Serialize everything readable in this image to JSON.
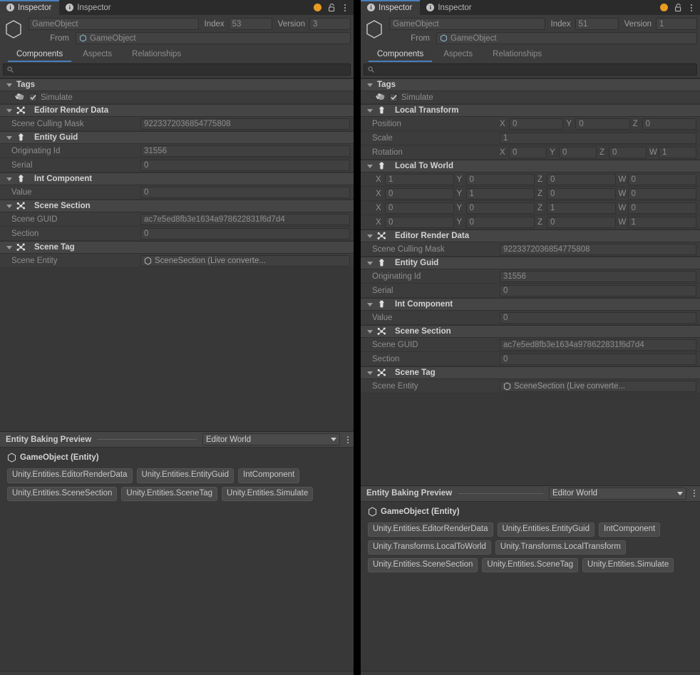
{
  "window": {
    "tabs": [
      {
        "label": "Inspector",
        "icon": "info-icon",
        "active": true
      },
      {
        "label": "Inspector",
        "icon": "info-icon",
        "active": false
      }
    ],
    "header_icons": [
      "status-dot-icon",
      "lock-open-icon",
      "kebab-menu-icon"
    ],
    "accent_color": "#4a7ebb",
    "status_dot_color": "#ea9b22"
  },
  "left": {
    "entity": {
      "name": "GameObject",
      "index_label": "Index",
      "index_value": "53",
      "version_label": "Version",
      "version_value": "3",
      "from_label": "From",
      "from_value": "GameObject"
    },
    "subtabs": [
      {
        "label": "Components",
        "active": true
      },
      {
        "label": "Aspects",
        "active": false
      },
      {
        "label": "Relationships",
        "active": false
      }
    ],
    "search": {
      "value": "",
      "placeholder": ""
    },
    "sections": [
      {
        "title": "Tags",
        "icon": "none",
        "rows": [
          {
            "kind": "toggle",
            "label": "Simulate",
            "checked": true,
            "icon": "tag-icon"
          }
        ]
      },
      {
        "title": "Editor Render Data",
        "icon": "shared-component-icon",
        "rows": [
          {
            "kind": "text",
            "label": "Scene Culling Mask",
            "value": "9223372036854775808"
          }
        ]
      },
      {
        "title": "Entity Guid",
        "icon": "component-icon",
        "rows": [
          {
            "kind": "text",
            "label": "Originating Id",
            "value": "31556"
          },
          {
            "kind": "text",
            "label": "Serial",
            "value": "0"
          }
        ]
      },
      {
        "title": "Int Component",
        "icon": "component-icon",
        "rows": [
          {
            "kind": "text",
            "label": "Value",
            "value": "0"
          }
        ]
      },
      {
        "title": "Scene Section",
        "icon": "shared-component-icon",
        "rows": [
          {
            "kind": "text",
            "label": "Scene GUID",
            "value": "ac7e5ed8fb3e1634a978622831f6d7d4"
          },
          {
            "kind": "text",
            "label": "Section",
            "value": "0"
          }
        ]
      },
      {
        "title": "Scene Tag",
        "icon": "shared-component-icon",
        "rows": [
          {
            "kind": "entity",
            "label": "Scene Entity",
            "value": "SceneSection (Live converte..."
          }
        ]
      }
    ],
    "preview": {
      "title": "Entity Baking Preview",
      "world": "Editor World",
      "entity_label": "GameObject (Entity)",
      "chips": [
        "Unity.Entities.EditorRenderData",
        "Unity.Entities.EntityGuid",
        "IntComponent",
        "Unity.Entities.SceneSection",
        "Unity.Entities.SceneTag",
        "Unity.Entities.Simulate"
      ]
    }
  },
  "right": {
    "entity": {
      "name": "GameObject",
      "index_label": "Index",
      "index_value": "51",
      "version_label": "Version",
      "version_value": "1",
      "from_label": "From",
      "from_value": "GameObject"
    },
    "subtabs": [
      {
        "label": "Components",
        "active": true
      },
      {
        "label": "Aspects",
        "active": false
      },
      {
        "label": "Relationships",
        "active": false
      }
    ],
    "search": {
      "value": "",
      "placeholder": ""
    },
    "sections": [
      {
        "title": "Tags",
        "icon": "none",
        "rows": [
          {
            "kind": "toggle",
            "label": "Simulate",
            "checked": true,
            "icon": "tag-icon"
          }
        ]
      },
      {
        "title": "Local Transform",
        "icon": "component-icon",
        "rows": [
          {
            "kind": "vector",
            "label": "Position",
            "axes": [
              [
                "X",
                "0"
              ],
              [
                "Y",
                "0"
              ],
              [
                "Z",
                "0"
              ]
            ]
          },
          {
            "kind": "scalar",
            "label": "Scale",
            "value": "1"
          },
          {
            "kind": "vector",
            "label": "Rotation",
            "axes": [
              [
                "X",
                "0"
              ],
              [
                "Y",
                "0"
              ],
              [
                "Z",
                "0"
              ],
              [
                "W",
                "1"
              ]
            ]
          }
        ]
      },
      {
        "title": "Local To World",
        "icon": "component-icon",
        "rows": [
          {
            "kind": "matrix",
            "axes": [
              [
                "X",
                "1"
              ],
              [
                "Y",
                "0"
              ],
              [
                "Z",
                "0"
              ],
              [
                "W",
                "0"
              ]
            ]
          },
          {
            "kind": "matrix",
            "axes": [
              [
                "X",
                "0"
              ],
              [
                "Y",
                "1"
              ],
              [
                "Z",
                "0"
              ],
              [
                "W",
                "0"
              ]
            ]
          },
          {
            "kind": "matrix",
            "axes": [
              [
                "X",
                "0"
              ],
              [
                "Y",
                "0"
              ],
              [
                "Z",
                "1"
              ],
              [
                "W",
                "0"
              ]
            ]
          },
          {
            "kind": "matrix",
            "axes": [
              [
                "X",
                "0"
              ],
              [
                "Y",
                "0"
              ],
              [
                "Z",
                "0"
              ],
              [
                "W",
                "1"
              ]
            ]
          }
        ]
      },
      {
        "title": "Editor Render Data",
        "icon": "shared-component-icon",
        "rows": [
          {
            "kind": "text",
            "label": "Scene Culling Mask",
            "value": "9223372036854775808"
          }
        ]
      },
      {
        "title": "Entity Guid",
        "icon": "component-icon",
        "rows": [
          {
            "kind": "text",
            "label": "Originating Id",
            "value": "31556"
          },
          {
            "kind": "text",
            "label": "Serial",
            "value": "0"
          }
        ]
      },
      {
        "title": "Int Component",
        "icon": "component-icon",
        "rows": [
          {
            "kind": "text",
            "label": "Value",
            "value": "0"
          }
        ]
      },
      {
        "title": "Scene Section",
        "icon": "shared-component-icon",
        "rows": [
          {
            "kind": "text",
            "label": "Scene GUID",
            "value": "ac7e5ed8fb3e1634a978622831f6d7d4"
          },
          {
            "kind": "text",
            "label": "Section",
            "value": "0"
          }
        ]
      },
      {
        "title": "Scene Tag",
        "icon": "shared-component-icon",
        "rows": [
          {
            "kind": "entity",
            "label": "Scene Entity",
            "value": "SceneSection (Live converte..."
          }
        ]
      }
    ],
    "preview": {
      "title": "Entity Baking Preview",
      "world": "Editor World",
      "entity_label": "GameObject (Entity)",
      "chips": [
        "Unity.Entities.EditorRenderData",
        "Unity.Entities.EntityGuid",
        "IntComponent",
        "Unity.Transforms.LocalToWorld",
        "Unity.Transforms.LocalTransform",
        "Unity.Entities.SceneSection",
        "Unity.Entities.SceneTag",
        "Unity.Entities.Simulate"
      ]
    }
  }
}
